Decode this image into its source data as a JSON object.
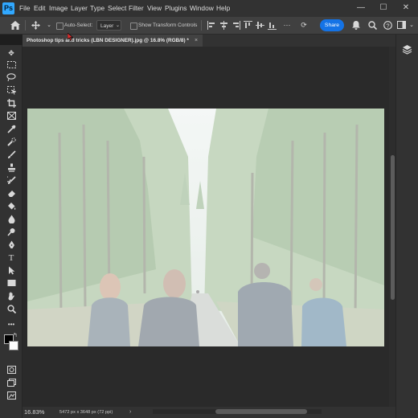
{
  "app": {
    "logo_text": "Ps",
    "menus": [
      "File",
      "Edit",
      "Image",
      "Layer",
      "Type",
      "Select",
      "Filter",
      "View",
      "Plugins",
      "Window",
      "Help"
    ],
    "window_controls": {
      "minimize": "—",
      "maximize": "☐",
      "close": "✕"
    }
  },
  "options_bar": {
    "auto_select_label": "Auto-Select:",
    "auto_select_target": "Layer",
    "show_transform_label": "Show Transform Controls",
    "share_label": "Share"
  },
  "document": {
    "tab_title": "Photoshop tips and tricks (LBN DESIGNER).jpg @ 16.8% (RGB/8) *",
    "close_glyph": "×"
  },
  "status": {
    "zoom": "16.83%",
    "doc_info": "5472 px x 3648 px (72 ppi)",
    "chevron": "›"
  },
  "colors": {
    "accent": "#1473e6",
    "ps_blue": "#31a8ff",
    "panel": "#323232",
    "canvas": "#2a2a2a"
  }
}
